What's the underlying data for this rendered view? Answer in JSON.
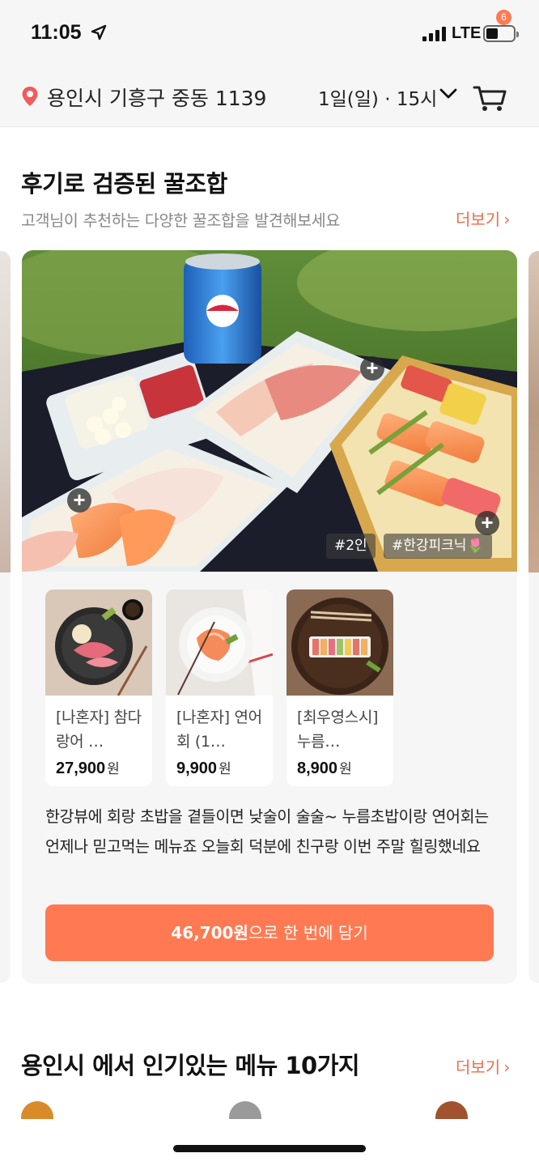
{
  "status_bar": {
    "time": "11:05",
    "network": "LTE"
  },
  "header": {
    "address": "용인시 기흥구 중동 1139",
    "delivery_time": "1일(일) · 15시",
    "cart_count": "6"
  },
  "combo_section": {
    "title": "후기로 검증된 꿀조합",
    "subtitle": "고객님이 추천하는 다양한 꿀조합을 발견해보세요",
    "more_label": "더보기",
    "card": {
      "tags": [
        "#2인",
        "#한강피크닉🌷"
      ],
      "products": [
        {
          "name": "[나혼자] 참다랑어 …",
          "price": "27,900",
          "currency": "원"
        },
        {
          "name": "[나혼자] 연어회 (1…",
          "price": "9,900",
          "currency": "원"
        },
        {
          "name": "[최우영스시] 누름…",
          "price": "8,900",
          "currency": "원"
        }
      ],
      "review": "한강뷰에 회랑 초밥을 곁들이면 낮술이 술술~ 누름초밥이랑 연어회는 언제나 믿고먹는 메뉴죠 오늘회 덕분에 친구랑 이번 주말 힐링했네요",
      "cta_amount": "46,700원",
      "cta_suffix": "으로 한 번에 담기"
    }
  },
  "popular_section": {
    "title": "용인시 에서 인기있는 메뉴 10가지",
    "more_label": "더보기"
  },
  "colors": {
    "accent": "#ff7a52",
    "accent_text": "#ee6d47",
    "card_bg": "#f6f6f6"
  }
}
